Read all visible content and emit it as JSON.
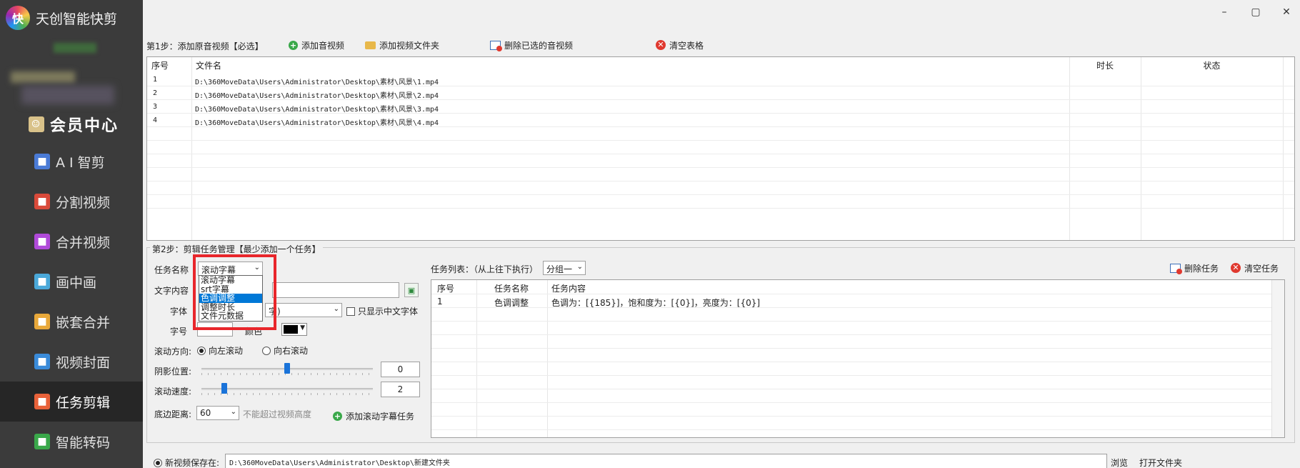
{
  "app": {
    "title": "天创智能快剪",
    "logo_text": "快"
  },
  "window": {
    "minimize": "–",
    "maximize": "▢",
    "close": "✕"
  },
  "sidebar": {
    "member": "会员中心",
    "items": [
      {
        "label": "A I 智剪",
        "icon": "ai-wand-icon",
        "color": "#4a7bd6"
      },
      {
        "label": "分割视频",
        "icon": "split-video-icon",
        "color": "#d94a3a"
      },
      {
        "label": "合并视频",
        "icon": "merge-video-icon",
        "color": "#b04ad9"
      },
      {
        "label": "画中画",
        "icon": "picture-in-picture-icon",
        "color": "#4aa8d9"
      },
      {
        "label": "嵌套合并",
        "icon": "nested-merge-icon",
        "color": "#e8a83a"
      },
      {
        "label": "视频封面",
        "icon": "video-cover-icon",
        "color": "#3a8bd9"
      },
      {
        "label": "任务剪辑",
        "icon": "task-edit-icon",
        "color": "#e8623a"
      },
      {
        "label": "智能转码",
        "icon": "transcode-icon",
        "color": "#3aa84a"
      }
    ]
  },
  "step1": {
    "label": "第1步：添加原音视频【必选】",
    "add_video": "添加音视频",
    "add_folder": "添加视频文件夹",
    "delete_selected": "删除已选的音视频",
    "clear_table": "清空表格",
    "columns": [
      "序号",
      "文件名",
      "时长",
      "状态"
    ],
    "rows": [
      {
        "index": "1",
        "file": "D:\\360MoveData\\Users\\Administrator\\Desktop\\素材\\风景\\1.mp4",
        "duration": "",
        "status": ""
      },
      {
        "index": "2",
        "file": "D:\\360MoveData\\Users\\Administrator\\Desktop\\素材\\风景\\2.mp4",
        "duration": "",
        "status": ""
      },
      {
        "index": "3",
        "file": "D:\\360MoveData\\Users\\Administrator\\Desktop\\素材\\风景\\3.mp4",
        "duration": "",
        "status": ""
      },
      {
        "index": "4",
        "file": "D:\\360MoveData\\Users\\Administrator\\Desktop\\素材\\风景\\4.mp4",
        "duration": "",
        "status": ""
      }
    ]
  },
  "step2": {
    "label": "第2步：剪辑任务管理【最少添加一个任务】",
    "task_name_label": "任务名称",
    "task_name_value": "滚动字幕",
    "dropdown_options": [
      "滚动字幕",
      "srt字幕",
      "色调调整",
      "调整时长",
      "文件元数据"
    ],
    "dropdown_selected_index": 2,
    "text_content_label": "文字内容",
    "text_content_value": "",
    "font_label": "字体",
    "font_value": "字)",
    "only_chinese": "只显示中文字体",
    "size_label": "字号",
    "size_value": "",
    "color_label": "颜色",
    "color_value": "#000000",
    "direction_label": "滚动方向:",
    "direction_left": "向左滚动",
    "direction_right": "向右滚动",
    "shadow_label": "阴影位置:",
    "shadow_value": "0",
    "shadow_level": 0.5,
    "speed_label": "滚动速度:",
    "speed_value": "2",
    "speed_level": 0.12,
    "bottom_margin_label": "底边距离:",
    "bottom_margin_value": "60",
    "bottom_margin_hint": "不能超过视频高度",
    "add_task": "添加滚动字幕任务"
  },
  "task_list": {
    "label": "任务列表：（从上往下执行）",
    "group_value": "分组一",
    "delete_task": "删除任务",
    "clear_tasks": "清空任务",
    "columns": [
      "序号",
      "任务名称",
      "任务内容"
    ],
    "rows": [
      {
        "index": "1",
        "name": "色调调整",
        "content": "色调为：[{185}]，饱和度为：[{0}]，亮度为：[{0}]"
      }
    ]
  },
  "bottom": {
    "save_label": "新视频保存在:",
    "save_path": "D:\\360MoveData\\Users\\Administrator\\Desktop\\新建文件夹",
    "browse": "浏览",
    "open_folder": "打开文件夹"
  }
}
